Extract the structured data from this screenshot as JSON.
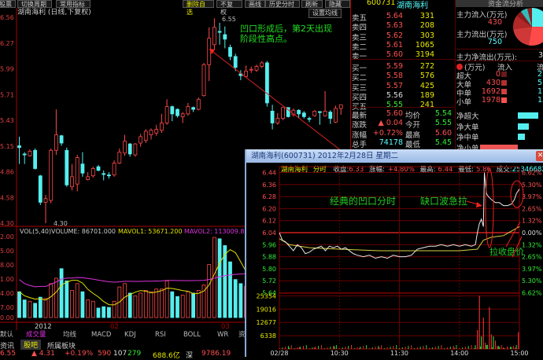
{
  "toolbar": {
    "left": [
      "股票",
      "切换周期",
      "常用指标"
    ],
    "right": [
      "删除自选",
      "不复权",
      "画线",
      "历史分时",
      "刷新",
      "隐藏"
    ]
  },
  "kline": {
    "title": "湖南海利 (日线,下复权)",
    "ma_button": "设置均线",
    "high_label": "6.55",
    "low_label": "4.30",
    "annotation_line1": "凹口形成后，第2天出现",
    "annotation_line2": "阶段性高点。",
    "price_ticks": [
      "6.56",
      "6.27",
      "5.99",
      "5.71",
      "5.43",
      "5.15",
      "4.86",
      "4.58",
      "4.30"
    ],
    "vol_header": {
      "vol": "VOL(5,40)",
      "volume": "VOLUME: 86701.000",
      "mavol1": "MAVOL1: 53671.200",
      "mavol2": "MAVOL2: 113009.80"
    },
    "vol_ticks": [
      "2.00",
      "5.00",
      "8.00",
      "1.00",
      "4.00",
      "7.00",
      "0.00"
    ],
    "date_labels": [
      "2012",
      "02",
      "03"
    ],
    "indicator_tabs": [
      "默认",
      "成交量",
      "均线",
      "MACD",
      "KDJ",
      "RSI",
      "BOLL",
      "WR",
      "资"
    ],
    "bottom_tabs": [
      "资讯",
      "股吧",
      "所属板块"
    ]
  },
  "status_bar": [
    "6.55",
    "▲ 4.31",
    "+0.19%",
    "590",
    "107",
    "279",
    "688.6亿",
    "深",
    "9786.19"
  ],
  "quote": {
    "code": "600731",
    "name": "湖南海利",
    "sell": [
      {
        "label": "卖五",
        "price": "5.64",
        "vol": "331"
      },
      {
        "label": "卖四",
        "price": "5.63",
        "vol": "208"
      },
      {
        "label": "卖三",
        "price": "5.62",
        "vol": "303"
      },
      {
        "label": "卖二",
        "price": "5.61",
        "vol": "1065"
      },
      {
        "label": "卖一",
        "price": "5.60",
        "vol": "3194"
      }
    ],
    "buy": [
      {
        "label": "买一",
        "price": "5.59",
        "vol": "272"
      },
      {
        "label": "买二",
        "price": "5.58",
        "vol": "576"
      },
      {
        "label": "买三",
        "price": "5.57",
        "vol": "425"
      },
      {
        "label": "买四",
        "price": "5.56",
        "vol": "189"
      },
      {
        "label": "买五",
        "price": "5.55",
        "vol": "241"
      }
    ],
    "stats": [
      {
        "l1": "最新",
        "v1": "5.60",
        "l2": "均价",
        "v2": "5.54"
      },
      {
        "l1": "涨跌",
        "v1": "▲ 0.04",
        "l2": "今开",
        "v2": "5.55"
      },
      {
        "l1": "涨幅",
        "v1": "+0.72%",
        "l2": "最高",
        "v2": "5.60"
      },
      {
        "l1": "总手",
        "v1": "74178",
        "l2": "最低",
        "v2": "5.45"
      }
    ]
  },
  "fund_flow": {
    "title": "资金流分析",
    "inflow_label": "主力流入(万元)",
    "inflow_value": "430",
    "outflow_label": "主力流出(万元)",
    "outflow_value": "750",
    "net_label": "主力净流出(万元):",
    "net_value": "3",
    "table_header": [
      "(万元)",
      "流入",
      "流出"
    ],
    "rows": [
      {
        "label": "超大",
        "in": "0",
        "out": "2"
      },
      {
        "label": "大单",
        "in": "430",
        "out": "5"
      },
      {
        "label": "中单",
        "in": "1692",
        "out": "170"
      },
      {
        "label": "小单",
        "in": "1978",
        "out": "150"
      }
    ],
    "net_rows": [
      {
        "label": "净超大",
        "value": 0.55,
        "color": "#55eeee"
      },
      {
        "label": "净大单",
        "value": 0.3,
        "color": "#55eeee"
      },
      {
        "label": "净中单",
        "value": 0.18,
        "color": "#55eeee"
      },
      {
        "label": "净小单",
        "value": -1.0,
        "color": "#ee5555"
      }
    ],
    "pie": [
      {
        "share": 0.25,
        "color": "#55eeee"
      },
      {
        "share": 0.28,
        "color": "#ff4a4a"
      },
      {
        "share": 0.2,
        "color": "#d03838"
      },
      {
        "share": 0.12,
        "color": "#b02828"
      },
      {
        "share": 0.05,
        "color": "#8a1a1a"
      },
      {
        "share": 0.06,
        "color": "#33bbbb"
      },
      {
        "share": 0.04,
        "color": "#882222"
      }
    ]
  },
  "popup": {
    "title": "湖南海利(600731)  2012年2月28日  星期二",
    "close": "✕",
    "header": {
      "name": "湖南海利",
      "type": "分时",
      "close_l": "收盘:",
      "close_v": "6.33",
      "chg_l": "涨幅:",
      "chg_v": "+4.80%",
      "high_l": "最高:",
      "high_v": "6.44",
      "low_l": "最低:",
      "low_v": "5.86",
      "vol_l": "成交:",
      "vol_v": "25346682"
    },
    "annotation1": "经典的凹口分时",
    "annotation2": "缺口波急拉",
    "annotation3": "拉收盘价"
  },
  "chart_data": [
    {
      "type": "candlestick",
      "title": "湖南海利 (日线,下复权)",
      "ylim": [
        4.3,
        6.56
      ],
      "candles": [
        [
          5.15,
          5.25,
          4.95,
          5.13
        ],
        [
          5.06,
          5.08,
          4.95,
          5.05
        ],
        [
          5.04,
          5.11,
          5.03,
          5.09
        ],
        [
          5.1,
          5.12,
          4.89,
          4.9
        ],
        [
          4.82,
          4.83,
          4.5,
          4.53
        ],
        [
          4.53,
          4.61,
          4.3,
          4.57
        ],
        [
          4.55,
          5.12,
          4.52,
          5.1
        ],
        [
          5.1,
          5.55,
          5.05,
          5.27
        ],
        [
          5.26,
          5.27,
          5.15,
          5.18
        ],
        [
          5.1,
          5.13,
          4.7,
          4.72
        ],
        [
          4.7,
          4.95,
          4.66,
          4.81
        ],
        [
          4.73,
          5.05,
          4.65,
          5.02
        ],
        [
          4.95,
          5.08,
          4.81,
          4.85
        ],
        [
          4.78,
          4.86,
          4.77,
          4.81
        ],
        [
          4.82,
          4.92,
          4.8,
          4.9
        ],
        [
          4.92,
          4.94,
          4.87,
          4.88
        ],
        [
          4.845,
          4.88,
          4.77,
          4.835
        ],
        [
          4.83,
          4.86,
          4.79,
          4.82
        ],
        [
          4.83,
          4.99,
          4.81,
          4.96
        ],
        [
          4.96,
          5.12,
          4.95,
          5.08
        ],
        [
          5.07,
          5.27,
          5.04,
          5.2
        ],
        [
          5.17,
          5.18,
          5.03,
          5.06
        ],
        [
          5.05,
          5.18,
          5.03,
          5.17
        ],
        [
          5.18,
          5.28,
          5.14,
          5.25
        ],
        [
          5.21,
          5.33,
          5.18,
          5.31
        ],
        [
          5.27,
          5.34,
          5.22,
          5.32
        ],
        [
          5.29,
          5.38,
          5.26,
          5.33
        ],
        [
          5.32,
          5.5,
          5.29,
          5.4
        ],
        [
          5.4,
          5.66,
          5.38,
          5.58
        ],
        [
          5.58,
          5.59,
          5.42,
          5.5
        ],
        [
          5.55,
          5.56,
          5.46,
          5.48
        ],
        [
          5.47,
          5.52,
          5.4,
          5.5
        ],
        [
          5.5,
          5.62,
          5.48,
          5.58
        ],
        [
          5.57,
          5.58,
          5.52,
          5.55
        ],
        [
          5.55,
          5.68,
          5.54,
          5.66
        ],
        [
          5.7,
          6.06,
          5.69,
          6.04
        ],
        [
          6.04,
          6.45,
          5.86,
          6.33
        ],
        [
          6.26,
          6.55,
          6.2,
          6.45
        ],
        [
          6.405,
          6.5,
          6.26,
          6.395
        ],
        [
          6.37,
          6.46,
          6.22,
          6.32
        ],
        [
          6.23,
          6.26,
          6.09,
          6.13
        ],
        [
          6.13,
          6.16,
          5.97,
          6.01
        ],
        [
          5.94,
          5.98,
          5.87,
          5.92
        ],
        [
          5.91,
          6.03,
          5.9,
          5.97
        ],
        [
          5.98,
          6.02,
          5.95,
          5.99
        ],
        [
          5.98,
          6.04,
          5.96,
          6.02
        ],
        [
          6.02,
          6.08,
          6.0,
          6.06
        ],
        [
          6.06,
          6.08,
          5.58,
          5.62
        ],
        [
          5.53,
          5.6,
          5.33,
          5.4
        ],
        [
          5.4,
          5.51,
          5.38,
          5.45
        ],
        [
          5.45,
          5.57,
          5.43,
          5.57
        ],
        [
          5.57,
          5.57,
          5.46,
          5.47
        ],
        [
          5.49,
          5.56,
          5.47,
          5.54
        ],
        [
          5.54,
          5.55,
          5.46,
          5.5
        ],
        [
          5.51,
          5.53,
          5.45,
          5.47
        ],
        [
          5.45,
          5.47,
          5.41,
          5.44
        ],
        [
          5.48,
          5.54,
          5.47,
          5.53
        ],
        [
          5.525,
          5.53,
          5.38,
          5.515
        ],
        [
          5.48,
          5.75,
          5.47,
          5.53
        ],
        [
          5.52,
          5.54,
          5.39,
          5.45
        ],
        [
          5.41,
          5.59,
          5.4,
          5.56
        ],
        [
          5.56,
          5.6,
          5.49,
          5.6
        ]
      ],
      "volume": [
        38,
        26,
        24,
        21,
        30,
        28,
        50,
        58,
        72,
        54,
        40,
        50,
        38,
        26,
        24,
        14,
        16,
        15,
        24,
        45,
        50,
        36,
        32,
        36,
        40,
        38,
        42,
        42,
        54,
        38,
        31,
        33,
        38,
        36,
        40,
        48,
        78,
        118,
        116,
        106,
        82,
        56,
        50,
        46,
        44,
        36,
        34,
        40,
        52,
        60,
        56,
        44,
        40,
        42,
        38,
        34,
        40,
        36,
        50,
        44,
        48,
        52
      ],
      "volume_unit": "thousand",
      "volume_ylim": [
        0,
        125
      ]
    },
    {
      "type": "line",
      "title": "湖南海利 分时 2012-02-28",
      "ylim": [
        5.64,
        6.44
      ],
      "prev_close": 6.04,
      "x_labels": [
        "02/28",
        "10:30",
        "11:30",
        "14:00",
        "15:00"
      ],
      "y_ticks": [
        "6.44",
        "6.36",
        "6.28",
        "6.20",
        "6.12",
        "6.04",
        "5.96",
        "5.88",
        "5.80",
        "5.72",
        "5.64"
      ],
      "pct_ticks": [
        "6.62%",
        "5.30%",
        "3.97%",
        "2.65%",
        "1.32%",
        "0.00%",
        "1.32%",
        "2.65%",
        "3.97%",
        "5.30%",
        "6.62%"
      ],
      "vol_ticks": [
        "25354",
        "19016",
        "12677",
        "6338"
      ],
      "vol_ylim": [
        0,
        27000
      ],
      "price_minutes": [
        0,
        3,
        6,
        10,
        14,
        18,
        22,
        26,
        30,
        34,
        38,
        42,
        46,
        50,
        54,
        58,
        62,
        66,
        70,
        74,
        78,
        84,
        90,
        96,
        102,
        108,
        114,
        120,
        126,
        132,
        138,
        144,
        150,
        156,
        162,
        168,
        174,
        180,
        186,
        192,
        196,
        198,
        200,
        202,
        204,
        205,
        207,
        209,
        212,
        216,
        220,
        224,
        228,
        232,
        235,
        237,
        240
      ],
      "price": [
        6.04,
        5.99,
        5.98,
        5.95,
        5.92,
        5.96,
        5.94,
        5.9,
        5.91,
        5.93,
        5.94,
        5.95,
        5.92,
        5.95,
        5.94,
        5.95,
        5.93,
        5.94,
        5.92,
        5.9,
        5.89,
        5.88,
        5.89,
        5.87,
        5.88,
        5.87,
        5.89,
        5.88,
        5.88,
        5.89,
        5.93,
        5.94,
        5.95,
        5.95,
        5.96,
        5.95,
        5.96,
        5.95,
        5.96,
        5.95,
        5.96,
        6.04,
        6.1,
        6.13,
        6.08,
        6.44,
        6.3,
        6.28,
        6.26,
        6.24,
        6.24,
        6.22,
        6.22,
        6.23,
        6.26,
        6.3,
        6.33
      ],
      "avg_minutes": [
        0,
        10,
        30,
        60,
        100,
        140,
        180,
        198,
        204,
        212,
        224,
        232,
        240
      ],
      "avg": [
        6.0,
        5.96,
        5.94,
        5.93,
        5.92,
        5.92,
        5.92,
        5.93,
        5.99,
        6.01,
        6.02,
        6.05,
        6.08
      ],
      "volume_minutes": [
        10,
        20,
        35,
        55,
        80,
        100,
        120,
        150,
        175,
        196,
        198,
        200,
        202,
        204,
        206,
        208,
        210,
        212,
        214,
        216,
        218,
        220,
        224,
        228,
        232,
        236,
        239
      ],
      "volume": [
        600,
        900,
        700,
        1300,
        500,
        700,
        400,
        500,
        600,
        1800,
        9000,
        25354,
        6000,
        15000,
        3000,
        2000,
        20000,
        7000,
        6000,
        4000,
        1500,
        1000,
        800,
        1200,
        900,
        700,
        8000
      ]
    }
  ],
  "colors": {
    "up": "#ff4a4a",
    "down": "#55eeee",
    "grid": "#8a0000",
    "ma1": "#e0e000",
    "ma2": "#dd33dd"
  }
}
